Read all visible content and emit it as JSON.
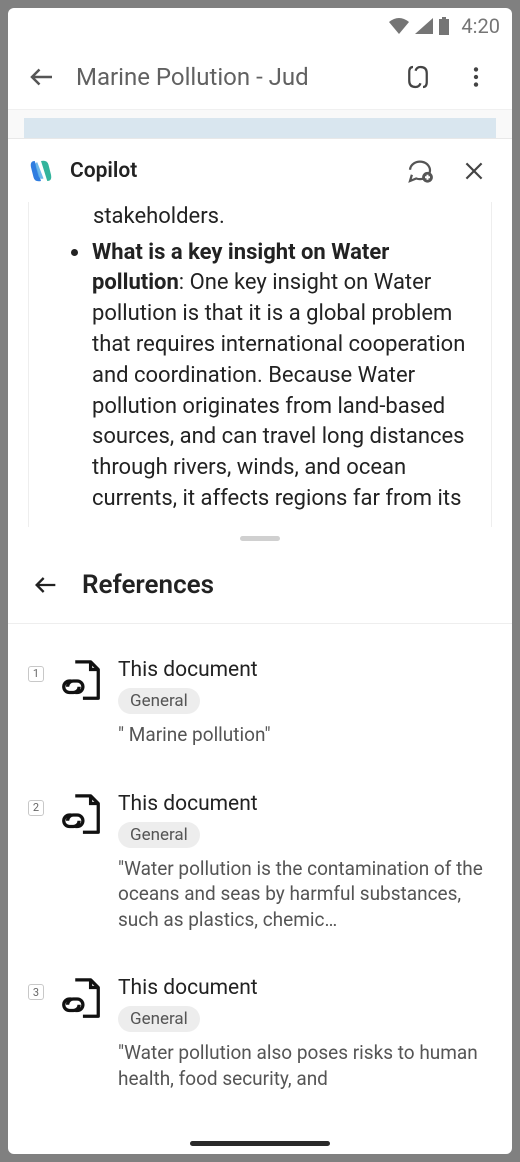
{
  "status_bar": {
    "time": "4:20"
  },
  "app_bar": {
    "title": "Marine Pollution - Jud"
  },
  "copilot": {
    "header_label": "Copilot",
    "trailing_line": "stakeholders.",
    "bullet_heading": "What is a key insight on Water pollution",
    "bullet_body": ": One key insight on Water pollution is that it is a global problem that requires international cooperation and coordination. Because Water pollution originates from land-based sources, and can travel long distances through rivers, winds, and ocean currents, it affects regions far from its"
  },
  "references": {
    "title": "References",
    "items": [
      {
        "index": "1",
        "title": "This document",
        "tag": "General",
        "snippet": "\" Marine pollution\""
      },
      {
        "index": "2",
        "title": "This document",
        "tag": "General",
        "snippet": "\"Water pollution is the contamination of the oceans and seas by harmful substances, such as plastics, chemic…"
      },
      {
        "index": "3",
        "title": "This document",
        "tag": "General",
        "snippet": "\"Water pollution also poses risks to human health, food security, and"
      }
    ]
  }
}
